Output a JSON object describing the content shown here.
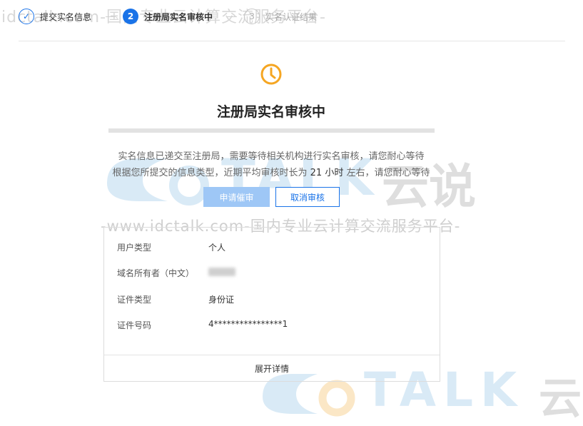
{
  "watermark": {
    "top": "idctalk.com-国内专业云计算交流服务平台-",
    "logo_word": "TALK",
    "logo_cn": "云说",
    "url": "-www.idctalk.com-国内专业云计算交流服务平台-",
    "bottom_word": "TALK",
    "bottom_cn": "云"
  },
  "steps": [
    {
      "index": "✓",
      "label": "提交实名信息",
      "state": "done"
    },
    {
      "index": "2",
      "label": "注册局实名审核中",
      "state": "active"
    },
    {
      "index": "3",
      "label": "实名认证结果",
      "state": "todo"
    }
  ],
  "status": {
    "icon": "clock-icon",
    "title": "注册局实名审核中",
    "desc_line1": "实名信息已递交至注册局，需要等待相关机构进行实名审核，请您耐心等待",
    "desc_line2_pre": "根据您所提交的信息类型，近期平均审核时长为 ",
    "desc_line2_hl": "21 小时",
    "desc_line2_post": " 左右，请您耐心等待"
  },
  "buttons": {
    "urge": "申请催审",
    "cancel": "取消审核"
  },
  "info": {
    "rows": [
      {
        "key": "用户类型",
        "value": "个人"
      },
      {
        "key": "域名所有者（中文）",
        "value": "",
        "blurred": true
      },
      {
        "key": "证件类型",
        "value": "身份证"
      },
      {
        "key": "证件号码",
        "value": "4****************1"
      }
    ],
    "expand": "展开详情"
  },
  "colors": {
    "primary": "#1a73e8",
    "pending": "#f5a623",
    "button_disabled": "#9ec7f6"
  }
}
